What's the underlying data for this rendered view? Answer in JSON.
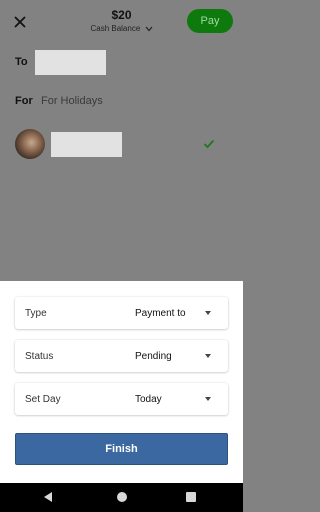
{
  "header": {
    "amount": "$20",
    "balance_label": "Cash Balance",
    "pay_label": "Pay"
  },
  "form": {
    "to_label": "To",
    "for_label": "For",
    "for_value": "For Holidays"
  },
  "sheet": {
    "rows": [
      {
        "label": "Type",
        "value": "Payment to"
      },
      {
        "label": "Status",
        "value": "Pending"
      },
      {
        "label": "Set Day",
        "value": "Today"
      }
    ],
    "finish_label": "Finish"
  },
  "icons": {
    "close": "close-icon",
    "balance_chevron": "chevron-down-icon",
    "selected": "check-icon",
    "nav_back": "back-icon",
    "nav_home": "home-icon",
    "nav_recents": "recents-icon"
  },
  "colors": {
    "pay_button": "#0e7a0e",
    "finish_button": "#3b68a0",
    "check": "#1a7a1a",
    "overlay": "#828282"
  }
}
